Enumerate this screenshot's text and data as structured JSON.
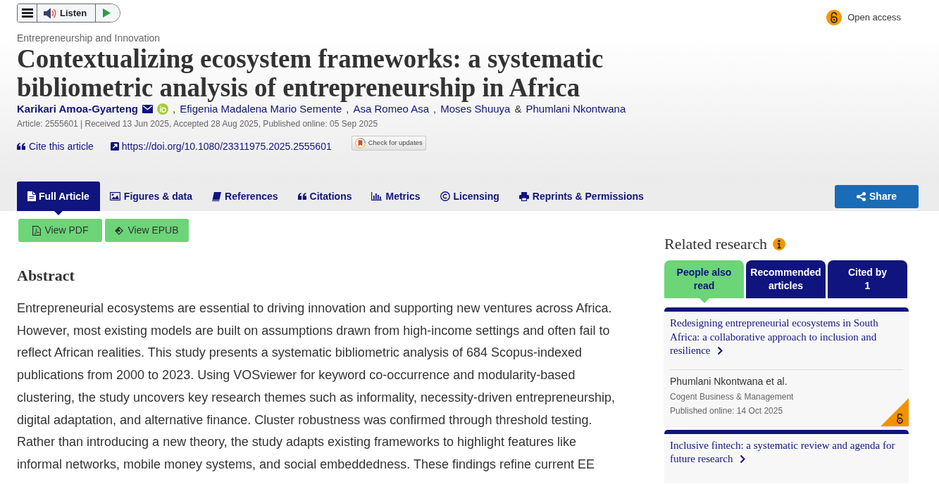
{
  "toolbar": {
    "listen": "Listen"
  },
  "open_access": {
    "label": "Open access"
  },
  "article": {
    "section": "Entrepreneurship and Innovation",
    "title": "Contextualizing ecosystem frameworks: a systematic bibliometric analysis of entrepreneurship in Africa",
    "authors": [
      {
        "name": "Karikari Amoa-Gyarteng",
        "email": true,
        "orcid": true
      },
      {
        "joiner": ",",
        "name": "Efigenia Madalena Mario Semente",
        "email": false,
        "orcid": false
      },
      {
        "joiner": ",",
        "name": "Asa Romeo Asa",
        "email": false,
        "orcid": false
      },
      {
        "joiner": ",",
        "name": "Moses Shuuya",
        "email": false,
        "orcid": false
      },
      {
        "joiner": "&",
        "name": "Phumlani Nkontwana",
        "email": false,
        "orcid": false
      }
    ],
    "meta": "Article: 2555601 | Received 13 Jun 2025, Accepted 28 Aug 2025, Published online: 05 Sep 2025",
    "cite": "Cite this article",
    "doi": "https://doi.org/10.1080/23311975.2025.2555601",
    "updates": "Check for updates"
  },
  "tabs": [
    {
      "kind": "article",
      "label": "Full Article",
      "selected": true
    },
    {
      "kind": "figures",
      "label": "Figures & data",
      "selected": false
    },
    {
      "kind": "references",
      "label": "References",
      "selected": false
    },
    {
      "kind": "citations",
      "label": "Citations",
      "selected": false
    },
    {
      "kind": "metrics",
      "label": "Metrics",
      "selected": false
    },
    {
      "kind": "licensing",
      "label": "Licensing",
      "selected": false
    },
    {
      "kind": "reprints",
      "label": "Reprints & Permissions",
      "selected": false
    }
  ],
  "share": {
    "label": "Share"
  },
  "downloads": [
    {
      "kind": "pdf",
      "label": "View PDF"
    },
    {
      "kind": "epub",
      "label": "View EPUB"
    }
  ],
  "abstract": {
    "heading": "Abstract",
    "text": "Entrepreneurial ecosystems are essential to driving innovation and supporting new ventures across Africa. However, most existing models are built on assumptions drawn from high-income settings and often fail to reflect African realities. This study presents a systematic bibliometric analysis of 684 Scopus-indexed publications from 2000 to 2023. Using VOSviewer for keyword co-occurrence and modularity-based clustering, the study uncovers key research themes such as informality, necessity-driven entrepreneurship, digital adaptation, and alternative finance. Cluster robustness was confirmed through threshold testing. Rather than introducing a new theory, the study adapts existing frameworks to highlight features like informal networks, mobile money systems, and social embeddedness. These findings refine current EE"
  },
  "related": {
    "heading": "Related research",
    "tabs": [
      {
        "label": "People also read",
        "selected": true
      },
      {
        "label": "Recommended articles",
        "selected": false
      },
      {
        "label": "Cited by",
        "count": "1",
        "selected": false
      }
    ],
    "articles": [
      {
        "title": "Redesigning entrepreneurial ecosystems in South Africa: a collaborative approach to inclusion and resilience",
        "authors": "Phumlani Nkontwana et al.",
        "journal": "Cogent Business & Management",
        "published": "Published online: 14 Oct 2025",
        "open_access": true
      },
      {
        "title": "Inclusive fintech: a systematic review and agenda for future research"
      }
    ]
  }
}
